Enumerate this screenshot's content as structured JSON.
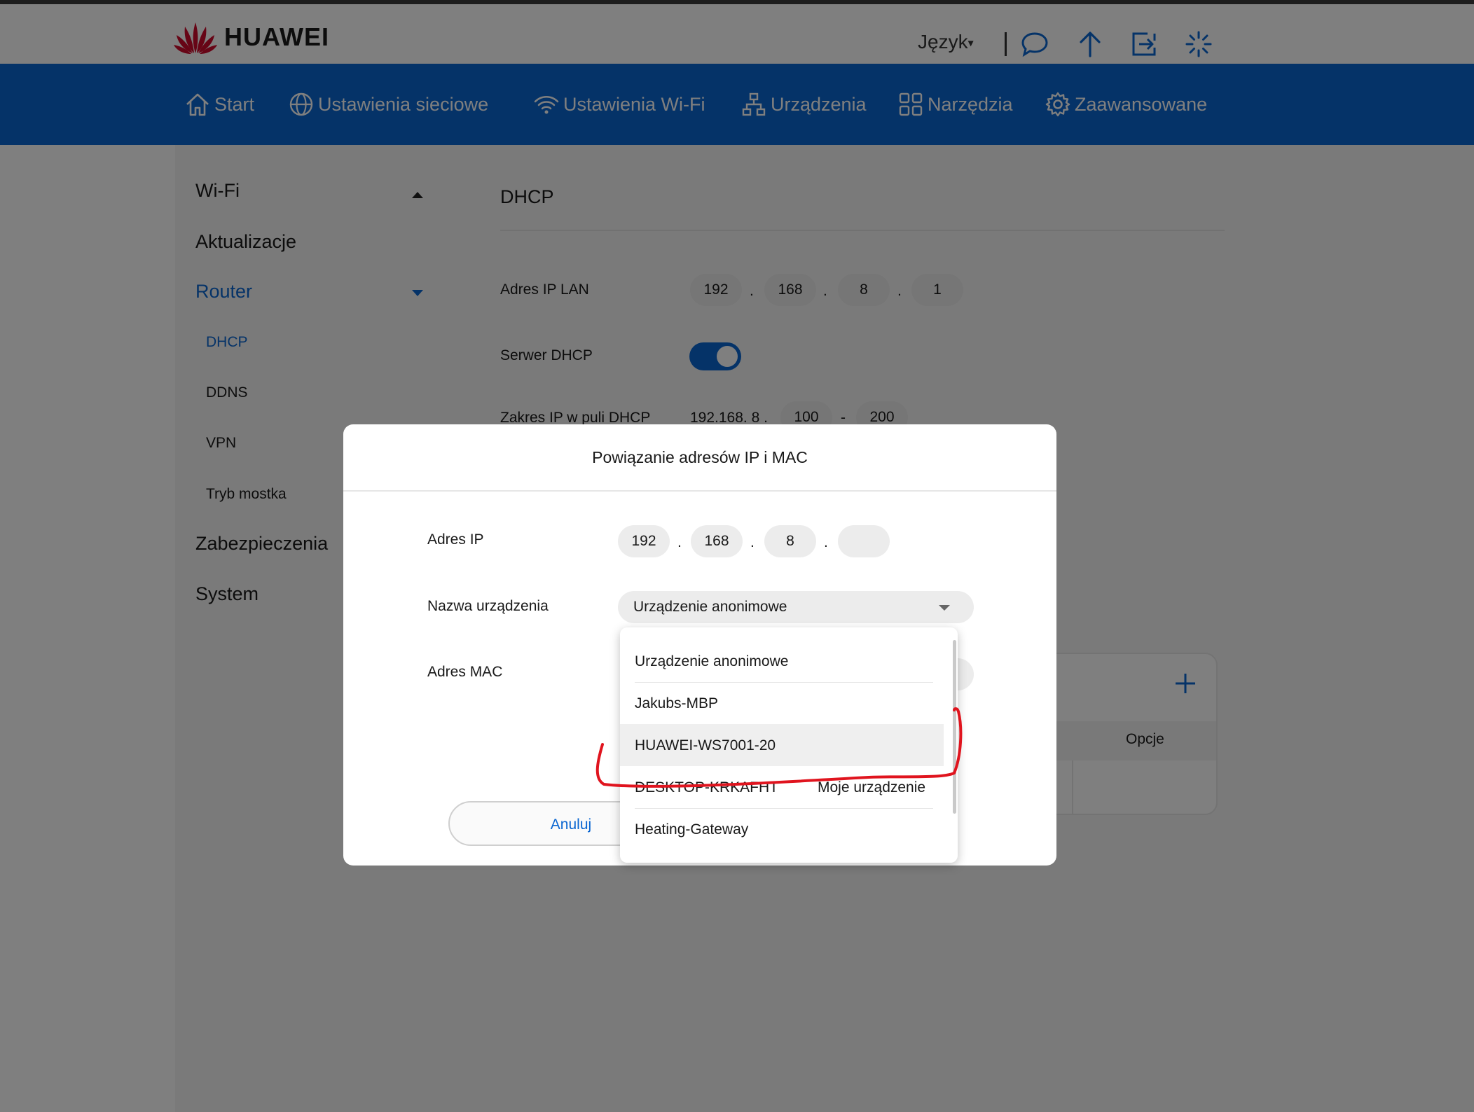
{
  "header": {
    "brand": "HUAWEI",
    "language_label": "Język",
    "icons": [
      "chat-icon",
      "upload-arrow-icon",
      "logout-icon",
      "loading-spinner-icon"
    ]
  },
  "nav": {
    "items": [
      {
        "label": "Start",
        "icon": "home-icon"
      },
      {
        "label": "Ustawienia sieciowe",
        "icon": "globe-icon"
      },
      {
        "label": "Ustawienia Wi-Fi",
        "icon": "wifi-icon"
      },
      {
        "label": "Urządzenia",
        "icon": "devices-icon"
      },
      {
        "label": "Narzędzia",
        "icon": "tools-grid-icon"
      },
      {
        "label": "Zaawansowane",
        "icon": "gear-icon"
      }
    ]
  },
  "sidebar": {
    "wifi": "Wi-Fi",
    "updates": "Aktualizacje",
    "router": "Router",
    "dhcp": "DHCP",
    "ddns": "DDNS",
    "vpn": "VPN",
    "bridge": "Tryb mostka",
    "security": "Zabezpieczenia",
    "system": "System"
  },
  "main": {
    "title": "DHCP",
    "lan_ip_label": "Adres IP LAN",
    "lan_ip": [
      "192",
      "168",
      "8",
      "1"
    ],
    "dhcp_server_label": "Serwer DHCP",
    "dhcp_server_on": true,
    "pool_label": "Zakres IP w puli DHCP",
    "pool_prefix": "192.168. 8 .",
    "pool_start": "100",
    "pool_sep": "-",
    "pool_end": "200",
    "options_header": "Opcje"
  },
  "modal": {
    "title": "Powiązanie adresów IP i MAC",
    "ip_label": "Adres IP",
    "ip": [
      "192",
      "168",
      "8",
      ""
    ],
    "device_name_label": "Nazwa urządzenia",
    "device_name_value": "Urządzenie anonimowe",
    "mac_label": "Adres MAC",
    "cancel_label": "Anuluj",
    "dropdown_options": [
      {
        "name": "Urządzenie anonimowe",
        "note": ""
      },
      {
        "name": "Jakubs-MBP",
        "note": ""
      },
      {
        "name": "HUAWEI-WS7001-20",
        "note": ""
      },
      {
        "name": "DESKTOP-KRKAFHT",
        "note": "Moje urządzenie"
      },
      {
        "name": "Heating-Gateway",
        "note": ""
      }
    ],
    "highlighted_option": "HUAWEI-WS7001-20"
  },
  "colors": {
    "brand_blue": "#0a66d1",
    "logo_red": "#cf0a2c",
    "annotation_red": "#e0141e"
  }
}
